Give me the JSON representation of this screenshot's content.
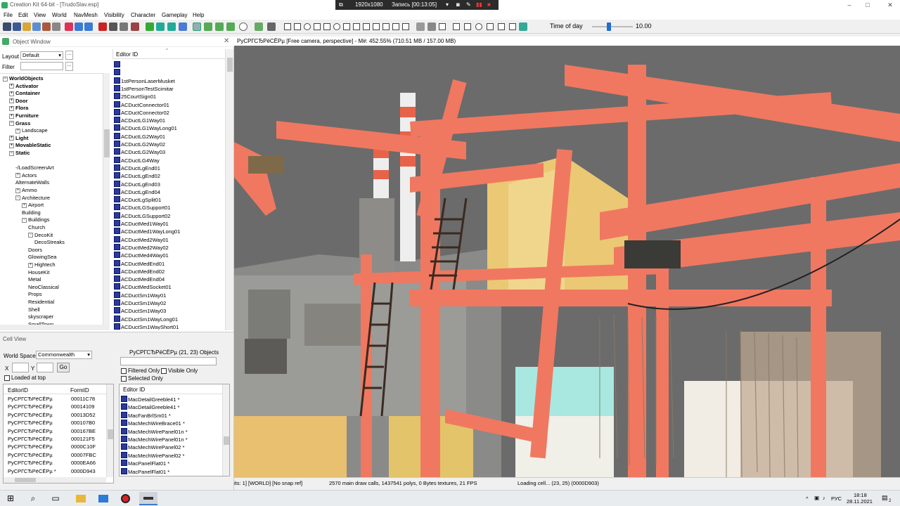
{
  "window": {
    "title": "Creation Kit 64-bit - [TrudoSlav.esp]",
    "controls": [
      "–",
      "□",
      "✕"
    ]
  },
  "recorder": {
    "resolution": "1920x1080",
    "recording": "Запись [00:13:05]"
  },
  "menu": [
    "File",
    "Edit",
    "View",
    "World",
    "NavMesh",
    "Visibility",
    "Character",
    "Gameplay",
    "Help"
  ],
  "toolbar": {
    "time_of_day_label": "Time of day",
    "time_of_day_value": "10.00",
    "time_of_day_fraction": 0.42
  },
  "object_window": {
    "title": "Object Window",
    "layout_label": "Layout",
    "layout_value": "Default",
    "filter_label": "Filter",
    "dots": "...",
    "list_header": "Editor ID",
    "tree": [
      {
        "label": "WorldObjects",
        "bold": true,
        "depth": 0,
        "exp": "−"
      },
      {
        "label": "Activator",
        "bold": true,
        "depth": 1,
        "exp": "+"
      },
      {
        "label": "Container",
        "bold": true,
        "depth": 1,
        "exp": "+"
      },
      {
        "label": "Door",
        "bold": true,
        "depth": 1,
        "exp": "+"
      },
      {
        "label": "Flora",
        "bold": true,
        "depth": 1,
        "exp": "+"
      },
      {
        "label": "Furniture",
        "bold": true,
        "depth": 1,
        "exp": "+"
      },
      {
        "label": "Grass",
        "bold": true,
        "depth": 1,
        "exp": "−"
      },
      {
        "label": "Landscape",
        "bold": false,
        "depth": 2,
        "exp": "+"
      },
      {
        "label": "Light",
        "bold": true,
        "depth": 1,
        "exp": "+"
      },
      {
        "label": "MovableStatic",
        "bold": true,
        "depth": 1,
        "exp": "+"
      },
      {
        "label": "Static",
        "bold": true,
        "depth": 1,
        "exp": "−"
      },
      {
        "label": "",
        "bold": false,
        "depth": 2,
        "exp": ""
      },
      {
        "label": "-/LoadScreenArt",
        "bold": false,
        "depth": 2,
        "exp": ""
      },
      {
        "label": "Actors",
        "bold": false,
        "depth": 2,
        "exp": "+"
      },
      {
        "label": "AlternateWalls",
        "bold": false,
        "depth": 2,
        "exp": ""
      },
      {
        "label": "Ammo",
        "bold": false,
        "depth": 2,
        "exp": "+"
      },
      {
        "label": "Architecture",
        "bold": false,
        "depth": 2,
        "exp": "−"
      },
      {
        "label": "Airport",
        "bold": false,
        "depth": 3,
        "exp": "+"
      },
      {
        "label": "Building",
        "bold": false,
        "depth": 3,
        "exp": ""
      },
      {
        "label": "Buildings",
        "bold": false,
        "depth": 3,
        "exp": "−"
      },
      {
        "label": "Church",
        "bold": false,
        "depth": 4,
        "exp": ""
      },
      {
        "label": "DecoKit",
        "bold": false,
        "depth": 4,
        "exp": "−"
      },
      {
        "label": "DecoStreaks",
        "bold": false,
        "depth": 5,
        "exp": ""
      },
      {
        "label": "Doors",
        "bold": false,
        "depth": 4,
        "exp": ""
      },
      {
        "label": "GlowingSea",
        "bold": false,
        "depth": 4,
        "exp": ""
      },
      {
        "label": "Hightech",
        "bold": false,
        "depth": 4,
        "exp": "+"
      },
      {
        "label": "HouseKit",
        "bold": false,
        "depth": 4,
        "exp": ""
      },
      {
        "label": "Metal",
        "bold": false,
        "depth": 4,
        "exp": ""
      },
      {
        "label": "NeoClassical",
        "bold": false,
        "depth": 4,
        "exp": ""
      },
      {
        "label": "Props",
        "bold": false,
        "depth": 4,
        "exp": ""
      },
      {
        "label": "Residential",
        "bold": false,
        "depth": 4,
        "exp": ""
      },
      {
        "label": "Shell",
        "bold": false,
        "depth": 4,
        "exp": ""
      },
      {
        "label": "skyscraper",
        "bold": false,
        "depth": 4,
        "exp": ""
      },
      {
        "label": "SmallTown",
        "bold": false,
        "depth": 4,
        "exp": ""
      }
    ],
    "objects": [
      "",
      "",
      "1stPersonLaserMusket",
      "1stPersonTestScimitar",
      "25CourtSign01",
      "ACDuctConnector01",
      "ACDuctConnector02",
      "ACDuctLG1Way01",
      "ACDuctLG1WayLong01",
      "ACDuctLG2Way01",
      "ACDuctLG2Way02",
      "ACDuctLG2Way03",
      "ACDuctLG4Way",
      "ACDuctLgEnd01",
      "ACDuctLgEnd02",
      "ACDuctLgEnd03",
      "ACDuctLgEnd04",
      "ACDuctLgSplit01",
      "ACDuctLGSupport01",
      "ACDuctLGSupport02",
      "ACDuctMed1Way01",
      "ACDuctMed1WayLong01",
      "ACDuctMed2Way01",
      "ACDuctMed2Way02",
      "ACDuctMed4Way01",
      "ACDuctMedEnd01",
      "ACDuctMedEnd02",
      "ACDuctMedEnd04",
      "ACDuctMedSocket01",
      "ACDuctSm1Way01",
      "ACDuctSm1Way02",
      "ACDuctSm1Way03",
      "ACDuctSm1WayLong01",
      "ACDuctSm1WayShort01"
    ]
  },
  "cell_view": {
    "title": "Cell View",
    "world_space_label": "World Space",
    "world_space_value": "Commonwealth",
    "x_label": "X",
    "y_label": "Y",
    "go_label": "Go",
    "loaded_at_top": "Loaded at top",
    "objects_header": "РуСРГСЂРёСЁРµ (21, 23) Objects",
    "filtered_only": "Filtered Only",
    "visible_only": "Visible Only",
    "selected_only": "Selected Only",
    "cells_headers": [
      "EditorID",
      "FormID"
    ],
    "cells": [
      {
        "editor_id": "РуСРГСЂРёСЁРµ",
        "form_id": "00011C78"
      },
      {
        "editor_id": "РуСРГСЂРёСЁРµ",
        "form_id": "00014109"
      },
      {
        "editor_id": "РуСРГСЂРёСЁРµ",
        "form_id": "00013D52"
      },
      {
        "editor_id": "РуСРГСЂРёСЁРµ",
        "form_id": "000107B0"
      },
      {
        "editor_id": "РуСРГСЂРёСЁРµ",
        "form_id": "000167BE"
      },
      {
        "editor_id": "РуСРГСЂРёСЁРµ",
        "form_id": "000121F5"
      },
      {
        "editor_id": "РуСРГСЂРёСЁРµ",
        "form_id": "0000C10F"
      },
      {
        "editor_id": "РуСРГСЂРёСЁРµ",
        "form_id": "00007FBC"
      },
      {
        "editor_id": "РуСРГСЂРёСЁРµ",
        "form_id": "0000EA66"
      },
      {
        "editor_id": "РуСРГСЂРёСЁРµ *",
        "form_id": "0000D943"
      }
    ],
    "objects_list_header": "Editor ID",
    "objects_list": [
      "MacDetailGreeble41 *",
      "MacDetailGreeble41 *",
      "MacFanBrlSm01 *",
      "MacMechWireBrace01 *",
      "MacMechWirePanel01n *",
      "MacMechWirePanel01n *",
      "MacMechWirePanel02 *",
      "MacMechWirePanel02 *",
      "MacPanelFlat01 *",
      "MacPanelFlat01 *"
    ]
  },
  "viewport": {
    "title": "РуСРГСЂРёСЁРµ [Free camera, perspective] - M#: 452.55% (710.51 MB / 157.00 MB)"
  },
  "status": {
    "left": "its: 1] [WORLD] [No snap ref]",
    "middle": "2570 main draw calls, 1437541 polys, 0 Bytes textures, 21 FPS",
    "right": "Loading cell... (23, 25) (0000D903)"
  },
  "taskbar": {
    "lang": "РУС",
    "time": "18:18",
    "date": "28.11.2021",
    "notifications": "2"
  },
  "colors": {
    "pipe": "#f07860",
    "crate_yellow": "#e8c070",
    "crate_cyan": "#a8e8e0",
    "object_icon": "#2a3b9c"
  }
}
